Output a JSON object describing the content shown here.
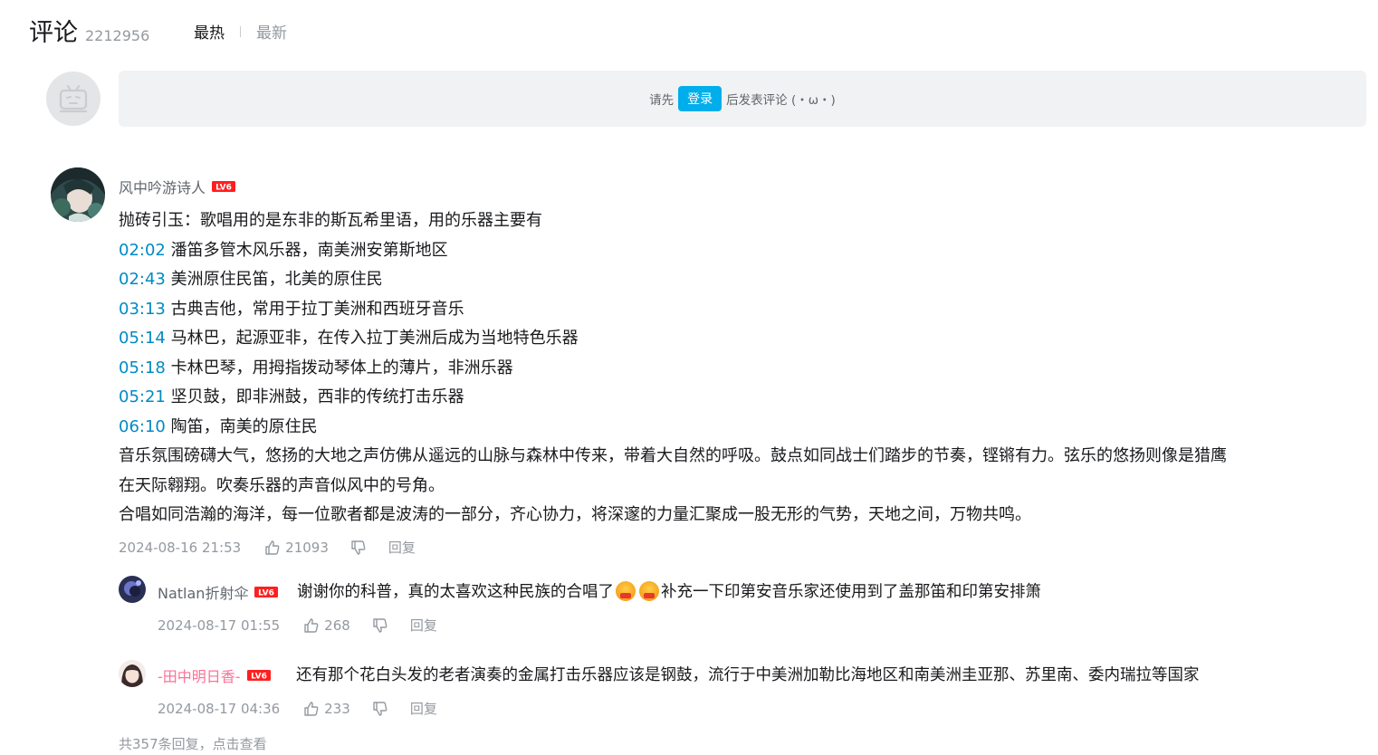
{
  "header": {
    "title": "评论",
    "count": "2212956",
    "sort_hot": "最热",
    "sort_new": "最新"
  },
  "login": {
    "prefix": "请先",
    "button": "登录",
    "suffix": "后发表评论 (・ω・)"
  },
  "comment": {
    "user": "风中吟游诗人",
    "level": "LV6",
    "intro": "抛砖引玉：歌唱用的是东非的斯瓦希里语，用的乐器主要有",
    "timestamps": [
      {
        "t": "02:02",
        "text": "潘笛多管木风乐器，南美洲安第斯地区"
      },
      {
        "t": "02:43",
        "text": "美洲原住民笛，北美的原住民"
      },
      {
        "t": "03:13",
        "text": "古典吉他，常用于拉丁美洲和西班牙音乐"
      },
      {
        "t": "05:14",
        "text": "马林巴，起源亚非，在传入拉丁美洲后成为当地特色乐器"
      },
      {
        "t": "05:18",
        "text": "卡林巴琴，用拇指拨动琴体上的薄片，非洲乐器"
      },
      {
        "t": "05:21",
        "text": "坚贝鼓，即非洲鼓，西非的传统打击乐器"
      },
      {
        "t": "06:10",
        "text": "陶笛，南美的原住民"
      }
    ],
    "para1_line1": "音乐氛围磅礴大气，悠扬的大地之声仿佛从遥远的山脉与森林中传来，带着大自然的呼吸。鼓点如同战士们踏步的节奏，铿锵有力。弦乐的悠扬则像是猎鹰",
    "para1_line2": "在天际翱翔。吹奏乐器的声音似风中的号角。",
    "para2": "合唱如同浩瀚的海洋，每一位歌者都是波涛的一部分，齐心协力，将深邃的力量汇聚成一股无形的气势，天地之间，万物共鸣。",
    "time": "2024-08-16 21:53",
    "likes": "21093",
    "reply": "回复"
  },
  "replies": [
    {
      "user": "Natlan折射伞",
      "level": "LV6",
      "text_a": "谢谢你的科普，真的太喜欢这种民族的合唱了",
      "text_b": "补充一下印第安音乐家还使用到了盖那笛和印第安排箫",
      "time": "2024-08-17 01:55",
      "likes": "268",
      "reply": "回复"
    },
    {
      "user": "-田中明日香-",
      "level": "LV6",
      "text": "还有那个花白头发的老者演奏的金属打击乐器应该是钢鼓，流行于中美洲加勒比海地区和南美洲圭亚那、苏里南、委内瑞拉等国家",
      "time": "2024-08-17 04:36",
      "likes": "233",
      "reply": "回复"
    }
  ],
  "more": "共357条回复，点击查看",
  "colors": {
    "accent": "#00aeec",
    "link": "#008ac5",
    "pink": "#fb7299",
    "level": "#ff1f1f"
  }
}
